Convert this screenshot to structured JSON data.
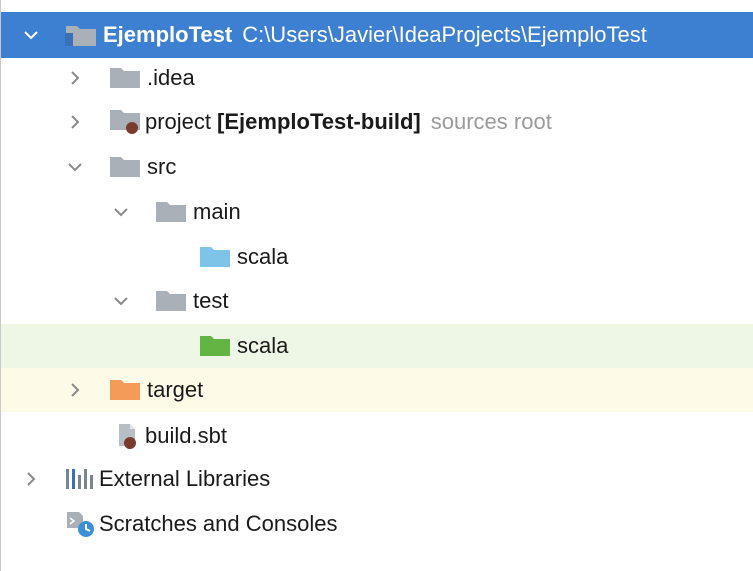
{
  "tree": {
    "root": {
      "name": "EjemploTest",
      "path": "C:\\Users\\Javier\\IdeaProjects\\EjemploTest"
    },
    "items": [
      {
        "label": ".idea"
      },
      {
        "label": "project",
        "module": "[EjemploTest-build]",
        "hint": "sources root"
      },
      {
        "label": "src"
      },
      {
        "label": "main"
      },
      {
        "label": "scala"
      },
      {
        "label": "test"
      },
      {
        "label": "scala"
      },
      {
        "label": "target"
      },
      {
        "label": "build.sbt"
      },
      {
        "label": "External Libraries"
      },
      {
        "label": "Scratches and Consoles"
      }
    ]
  },
  "colors": {
    "selection": "#3d7fd1",
    "folder_gray": "#a9b0b8",
    "folder_source": "#7ec4e8",
    "folder_test": "#62b543",
    "folder_excluded": "#f39c5a",
    "test_row_bg": "#eef6e6",
    "excluded_row_bg": "#fdfbe7"
  }
}
